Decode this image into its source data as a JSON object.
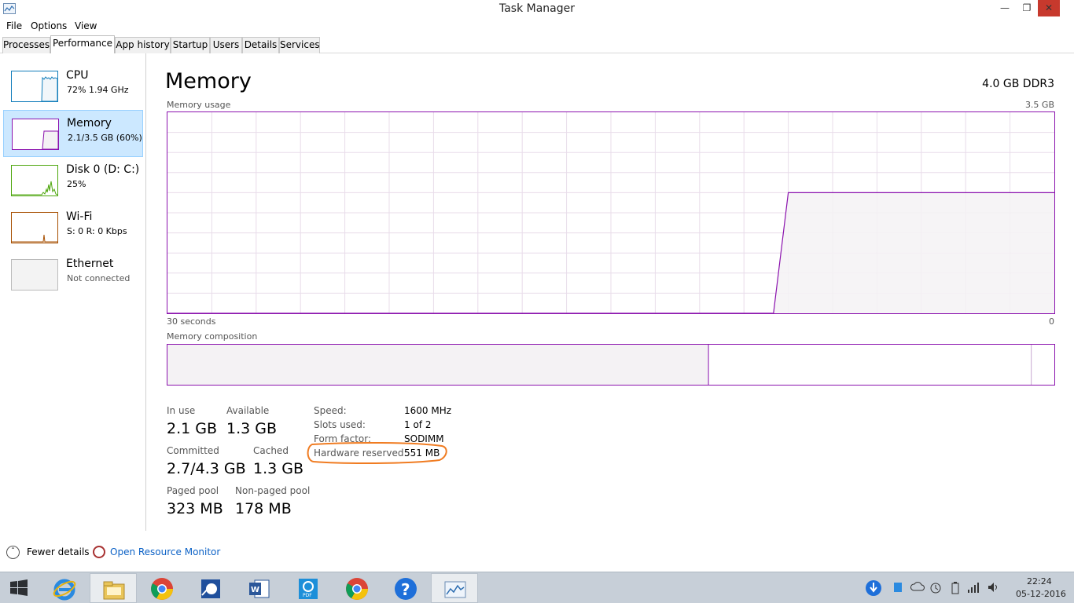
{
  "window": {
    "title": "Task Manager"
  },
  "menu": [
    "File",
    "Options",
    "View"
  ],
  "tabs": [
    "Processes",
    "Performance",
    "App history",
    "Startup",
    "Users",
    "Details",
    "Services"
  ],
  "active_tab": "Performance",
  "resources": [
    {
      "name": "CPU",
      "detail": "72%  1.94 GHz",
      "color": "#117dbb"
    },
    {
      "name": "Memory",
      "detail": "2.1/3.5 GB (60%)",
      "color": "#8b12ae"
    },
    {
      "name": "Disk 0 (D: C:)",
      "detail": "25%",
      "color": "#4da60c"
    },
    {
      "name": "Wi-Fi",
      "detail": "S: 0  R: 0 Kbps",
      "color": "#a74f01"
    },
    {
      "name": "Ethernet",
      "detail": "Not connected",
      "color": "#bbbbbb"
    }
  ],
  "memory": {
    "title": "Memory",
    "spec": "4.0 GB DDR3",
    "usage_label": "Memory usage",
    "usage_max": "3.5 GB",
    "time_left": "30 seconds",
    "time_right": "0",
    "composition_label": "Memory composition",
    "usage_history_percent": [
      0,
      0,
      0,
      0,
      0,
      0,
      0,
      0,
      0,
      0,
      0,
      0,
      0,
      0,
      0,
      0,
      0,
      0,
      0,
      0,
      0,
      0,
      0,
      0,
      0,
      0,
      0,
      0,
      0,
      0,
      0,
      0,
      0,
      0,
      0,
      0,
      0,
      0,
      0,
      0,
      0,
      0,
      60,
      60,
      60,
      60,
      60,
      60,
      60,
      60,
      60,
      60,
      60,
      60,
      60,
      60,
      60,
      60,
      60,
      60,
      60
    ],
    "composition_in_use_fraction": 0.61,
    "composition_standby_end_fraction": 0.974,
    "stats": {
      "in_use_label": "In use",
      "in_use": "2.1 GB",
      "available_label": "Available",
      "available": "1.3 GB",
      "committed_label": "Committed",
      "committed": "2.7/4.3 GB",
      "cached_label": "Cached",
      "cached": "1.3 GB",
      "paged_label": "Paged pool",
      "paged": "323 MB",
      "nonpaged_label": "Non-paged pool",
      "nonpaged": "178 MB"
    },
    "details": [
      {
        "label": "Speed:",
        "value": "1600 MHz"
      },
      {
        "label": "Slots used:",
        "value": "1 of 2"
      },
      {
        "label": "Form factor:",
        "value": "SODIMM"
      },
      {
        "label": "Hardware reserved:",
        "value": "551 MB"
      }
    ]
  },
  "footer": {
    "fewer_details": "Fewer details",
    "resource_monitor": "Open Resource Monitor"
  },
  "colors": {
    "accent": "#8b12ae",
    "fill": "#f4f2f4",
    "highlight": "#f07c22",
    "selected_bg": "#cce8ff"
  },
  "taskbar": {
    "apps": [
      "windows-logo-icon",
      "internet-explorer-icon",
      "file-explorer-icon",
      "chrome-icon",
      "app-icon",
      "word-icon",
      "pdf-icon",
      "chrome-icon",
      "help-icon",
      "task-manager-icon"
    ],
    "time": "22:24",
    "date": "05-12-2016"
  }
}
